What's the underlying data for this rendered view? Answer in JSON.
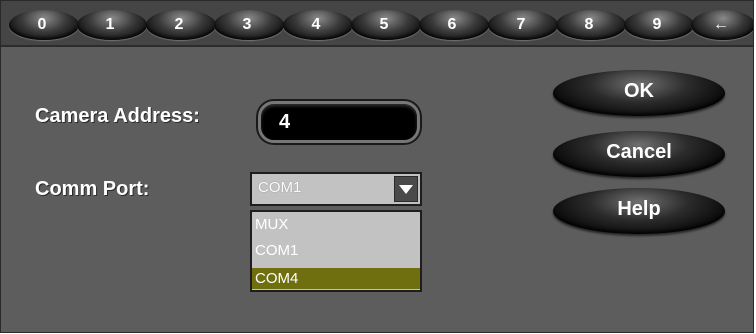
{
  "keypad": {
    "keys": [
      "0",
      "1",
      "2",
      "3",
      "4",
      "5",
      "6",
      "7",
      "8",
      "9",
      "←"
    ]
  },
  "camera_address": {
    "label": "Camera Address:",
    "value": "4"
  },
  "comm_port": {
    "label": "Comm Port:",
    "selected": "COM1",
    "options": [
      "MUX",
      "COM1",
      "COM4"
    ],
    "highlighted": "COM4"
  },
  "buttons": {
    "ok": "OK",
    "cancel": "Cancel",
    "help": "Help"
  },
  "colors": {
    "dialog_bg": "#5d5d5d",
    "highlight": "#6f6f10"
  }
}
